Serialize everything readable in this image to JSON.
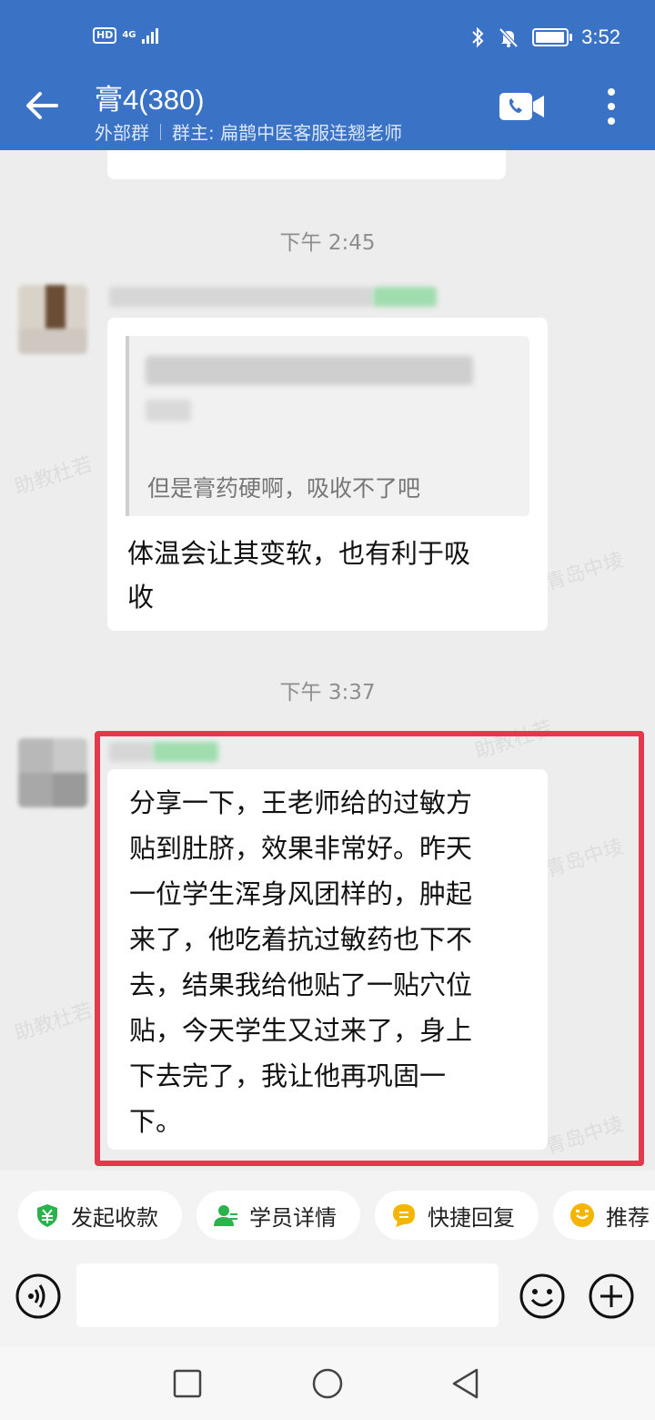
{
  "status_bar": {
    "hd_label": "HD",
    "network_label": "4G",
    "time": "3:52"
  },
  "header": {
    "title": "膏4(380)",
    "group_type": "外部群",
    "owner": "群主: 扁鹊中医客服连翘老师"
  },
  "chat": {
    "top_partial_text": "但是膏药硬啊，吸收不了吧",
    "messages": [
      {
        "timestamp": "下午 2:45",
        "quote": "但是膏药硬啊，吸收不了吧",
        "text_lines": [
          "体温会让其变软，也有利于吸",
          "收"
        ]
      },
      {
        "timestamp": "下午 3:37",
        "text_lines": [
          "分享一下，王老师给的过敏方",
          "贴到肚脐，效果非常好。昨天",
          "一位学生浑身风团样的，肿起",
          "来了，他吃着抗过敏药也下不",
          "去，结果我给他贴了一贴穴位",
          "贴，今天学生又过来了，身上",
          "下去完了，我让他再巩固一",
          "下。"
        ]
      }
    ],
    "watermarks": [
      "助教杜若",
      "助教杜若",
      "助教杜若",
      "青岛中堎",
      "青岛中堎",
      "青岛中堎"
    ]
  },
  "quick_actions": [
    {
      "label": "发起收款",
      "icon": "payment-icon",
      "color": "#2bb24c"
    },
    {
      "label": "学员详情",
      "icon": "student-icon",
      "color": "#2bb24c"
    },
    {
      "label": "快捷回复",
      "icon": "quick-reply-icon",
      "color": "#f5b400"
    },
    {
      "label": "推荐",
      "icon": "recommend-icon",
      "color": "#f5b400"
    }
  ],
  "input": {
    "placeholder": "",
    "value": ""
  },
  "colors": {
    "header_bg": "#3a72c6",
    "highlight": "#e23a4c",
    "chat_bg": "#ededed"
  }
}
